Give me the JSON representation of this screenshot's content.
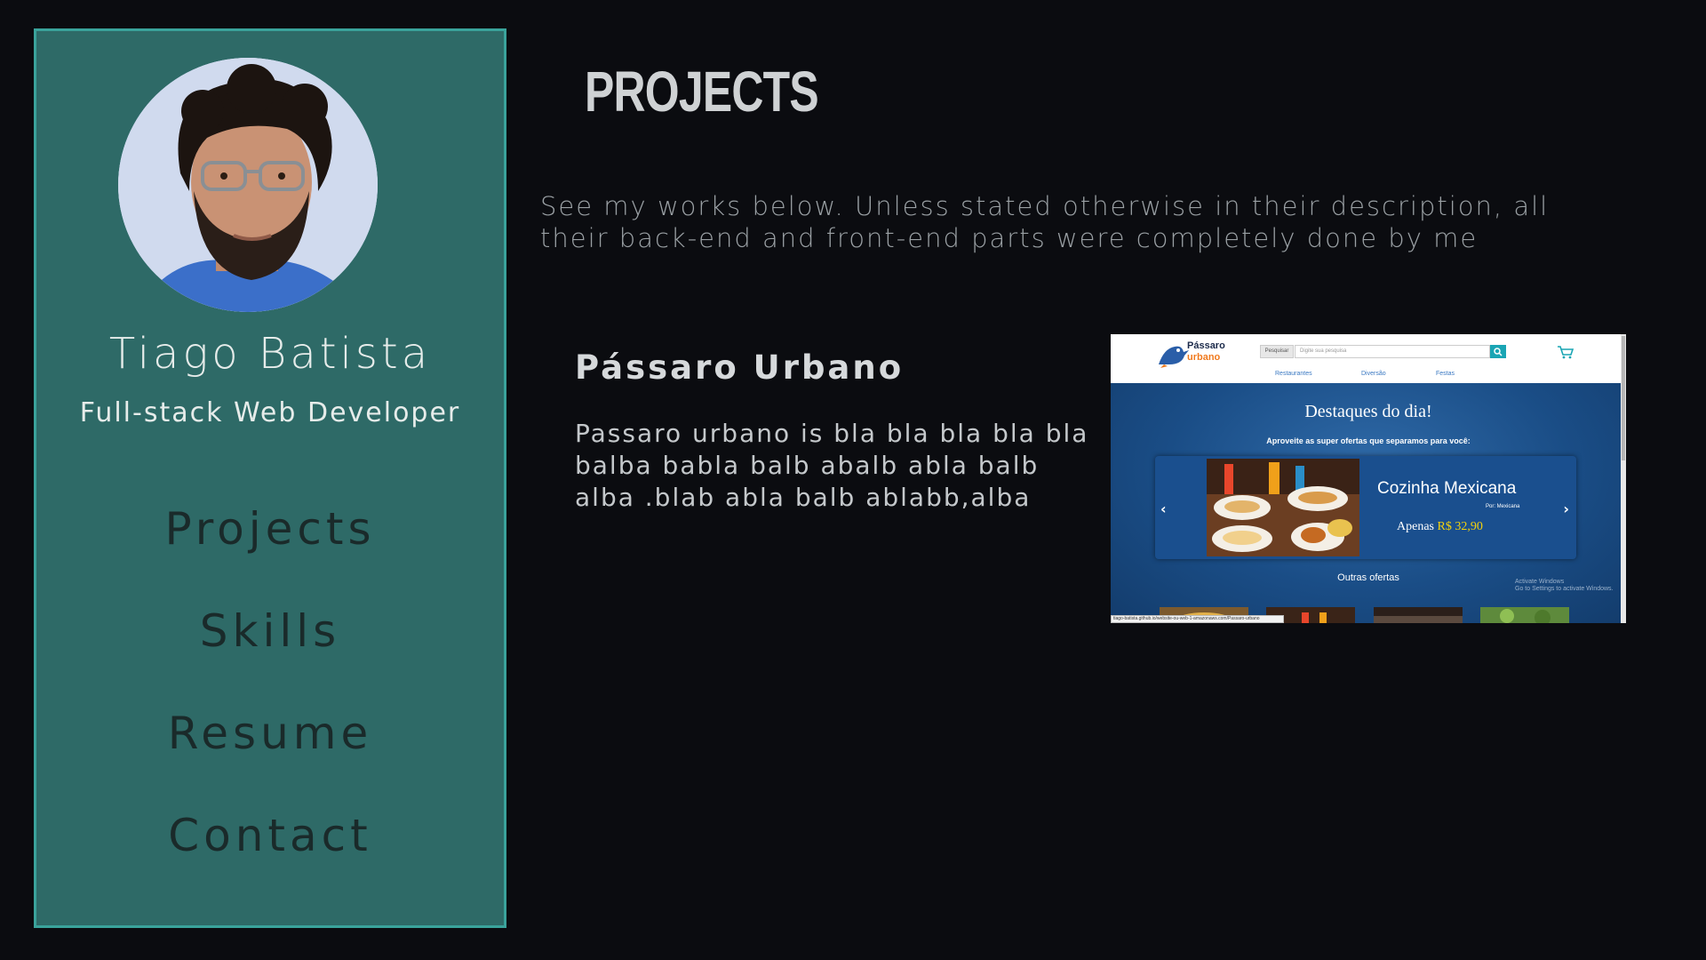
{
  "profile": {
    "name": "Tiago Batista",
    "role": "Full-stack Web Developer"
  },
  "nav": {
    "items": [
      "Projects",
      "Skills",
      "Resume",
      "Contact"
    ]
  },
  "main": {
    "title": "PROJECTS",
    "intro": "See my works below. Unless stated otherwise in their description, all their back-end and front-end parts were completely done by me"
  },
  "project": {
    "title": "Pássaro Urbano",
    "description": "Passaro urbano is bla bla bla bla bla balba babla balb abalb abla balb alba .blab abla balb ablabb,alba"
  },
  "screenshot": {
    "logo_line1": "Pássaro",
    "logo_line2": "urbano",
    "search_button": "Pesquisar",
    "search_placeholder": "Digite sua pesquisa",
    "nav_links": [
      "Restaurantes",
      "Diversão",
      "Festas"
    ],
    "headline": "Destaques do dia!",
    "subheadline": "Aproveite as super ofertas que separamos para você:",
    "card_title": "Cozinha Mexicana",
    "card_by": "Por: Mexicana",
    "card_price_prefix": "Apenas",
    "card_price": "R$ 32,90",
    "other_offers": "Outras ofertas",
    "watermark_line1": "Activate Windows",
    "watermark_line2": "Go to Settings to activate Windows.",
    "status_bar": "tiago-batista.github.io/website-ou-web-1-amazonaws.com/Passaro-urbano"
  },
  "colors": {
    "page_background": "#0b0c10",
    "sidebar_background": "#2e6a67",
    "sidebar_border": "#3aa39b",
    "nav_text": "#1a2a2a",
    "price_highlight": "#f5d20c"
  },
  "icons": {
    "avatar": "profile-photo",
    "cart": "cart-icon",
    "prev": "chevron-left-icon",
    "next": "chevron-right-icon",
    "search": "search-icon"
  }
}
